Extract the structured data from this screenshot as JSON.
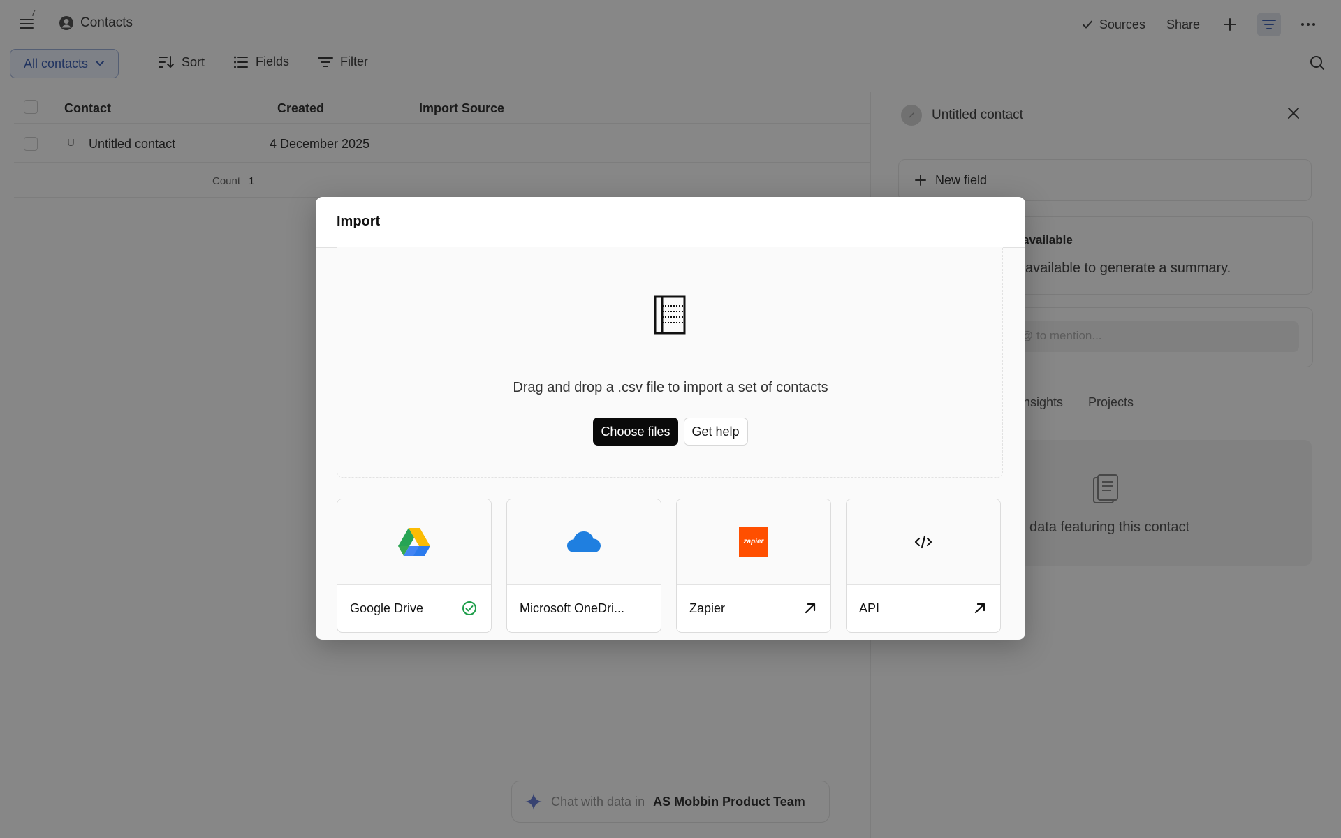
{
  "topbar": {
    "badge": "7",
    "title": "Contacts",
    "sources_label": "Sources",
    "share_label": "Share"
  },
  "toolbar": {
    "view": "All contacts",
    "sort": "Sort",
    "fields": "Fields",
    "filter": "Filter"
  },
  "table": {
    "columns": [
      "Contact",
      "Created",
      "Import Source"
    ],
    "rows": [
      {
        "initial": "U",
        "contact": "Untitled contact",
        "created": "4 December 2025",
        "import_source": ""
      }
    ],
    "count_label": "Count",
    "count_value": "1"
  },
  "side_panel": {
    "title": "Untitled contact",
    "new_field": "New field",
    "summary_title": "available",
    "summary_text": "available to generate a summary.",
    "comment_placeholder": "@ to mention...",
    "tabs": [
      "Insights",
      "Projects"
    ],
    "empty_text": "data featuring this contact"
  },
  "chat": {
    "prefix": "Chat with data in",
    "team": "AS Mobbin Product Team"
  },
  "modal": {
    "title": "Import",
    "drop_text": "Drag and drop a .csv file to import a set of contacts",
    "choose_files": "Choose files",
    "get_help": "Get help",
    "sources": [
      {
        "label": "Google Drive",
        "status_icon": "check-circle-icon",
        "logo": "google-drive-logo"
      },
      {
        "label": "Microsoft OneDri...",
        "status_icon": "",
        "logo": "onedrive-logo"
      },
      {
        "label": "Zapier",
        "status_icon": "arrow-up-right-icon",
        "logo": "zapier-logo",
        "logo_text": "zapier"
      },
      {
        "label": "API",
        "status_icon": "arrow-up-right-icon",
        "logo": "code-icon"
      }
    ]
  },
  "colors": {
    "accent_blue": "#3f62b6",
    "success_green": "#1e9e4a",
    "zapier_orange": "#ff4f00",
    "onedrive_blue": "#1f7fe0"
  }
}
